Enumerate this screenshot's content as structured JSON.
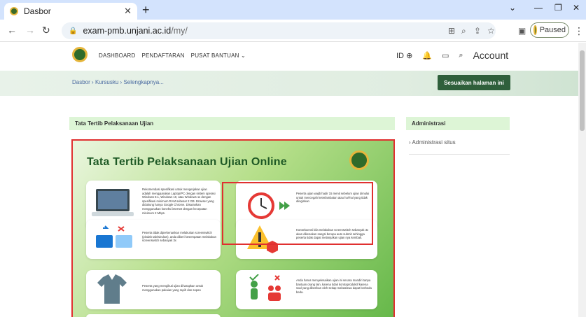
{
  "browser": {
    "tab_title": "Dasbor",
    "tab_close": "✕",
    "new_tab": "+",
    "url_host": "exam-pmb.unjani.ac.id",
    "url_path": "/my/",
    "profile_status": "Paused",
    "window_controls": [
      "⌄",
      "—",
      "❐",
      "✕"
    ]
  },
  "nav": {
    "items": [
      "DASHBOARD",
      "PENDAFTARAN",
      "PUSAT BANTUAN ⌄"
    ],
    "language": "ID",
    "account_label": "Account"
  },
  "breadcrumb": {
    "items": [
      "Dasbor",
      "Kursusku",
      "Selengkapnya..."
    ],
    "separator": "›"
  },
  "customize_button": "Sesuaikan halaman ini",
  "main_block": {
    "title": "Tata Tertib Pelaksanaan Ujian"
  },
  "sidebar": {
    "title": "Administrasi",
    "items": [
      "› Administrasi situs"
    ]
  },
  "poster": {
    "title": "Tata Tertib Pelaksanaan Ujian Online",
    "cards": [
      {
        "text": "Rekomendasi spesifikasi untuk mengerjakan ujian adalah menggunakan Laptop/PC dengan sistem operasi Windows 8.1, Windows 10, atau Windows 11 dengan spesifikasi minimum RAM sebesar 2 GB. Browser yang didukung hanya Google Chrome. Disarankan menggunakan koneksi internet dengan kecepatan minimum 2 Mbps."
      },
      {
        "text": "Peserta ujian wajib hadir 15 menit sebelum ujian dimulai untuk mencegah keterlambatan atau hal-hal yang tidak diinginkan"
      },
      {
        "text": "Peserta yang mengikuti ujian diharapkan untuk menggunakan pakaian yang rapih dan sopan"
      },
      {
        "text": "Anda harus menyelesaikan ujian ini secara mandiri tanpa bantuan orang lain, karena tidak kontraproduktif karena soal yang diberikan oleh setiap mahasiswa dapat berbeda beda."
      },
      {
        "text": "Peserta tidak diperkenankan melakukan screenswitch (pindah tab/window), anda diberi kesempatan melakukan screenswitch sebanyak 3x"
      },
      {
        "text": "Konsekuensi bila melakukan screenswitch sebanyak 3x akan dikenakan sangsi berupa auto submit sehingga peserta tidak dapat melanjutkan ujian nya kembali."
      }
    ]
  },
  "colors": {
    "brand_green": "#2f5f3b",
    "block_header_bg": "#ddf5d6",
    "highlight_red": "#e03030",
    "tabbar": "#d3e3fd"
  }
}
